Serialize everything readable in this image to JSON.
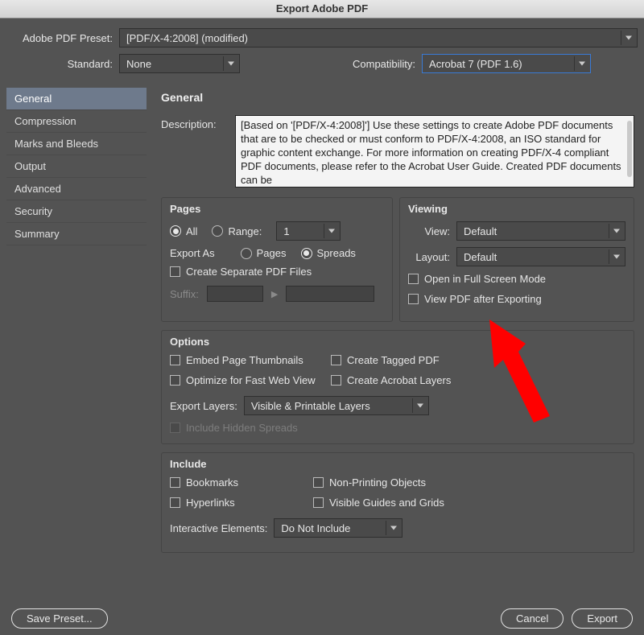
{
  "title": "Export Adobe PDF",
  "top": {
    "preset_label": "Adobe PDF Preset:",
    "preset_value": "[PDF/X-4:2008] (modified)",
    "standard_label": "Standard:",
    "standard_value": "None",
    "compat_label": "Compatibility:",
    "compat_value": "Acrobat 7 (PDF 1.6)"
  },
  "sidebar": {
    "items": [
      {
        "label": "General"
      },
      {
        "label": "Compression"
      },
      {
        "label": "Marks and Bleeds"
      },
      {
        "label": "Output"
      },
      {
        "label": "Advanced"
      },
      {
        "label": "Security"
      },
      {
        "label": "Summary"
      }
    ],
    "active_index": 0
  },
  "panel": {
    "title": "General",
    "description_label": "Description:",
    "description_text": "[Based on '[PDF/X-4:2008]'] Use these settings to create Adobe PDF documents that are to be checked or must conform to PDF/X-4:2008, an ISO standard for graphic content exchange.  For more information on creating PDF/X-4 compliant PDF documents, please refer to the Acrobat User Guide.  Created PDF documents can be"
  },
  "pages": {
    "title": "Pages",
    "all": "All",
    "range": "Range:",
    "range_value": "1",
    "export_as": "Export As",
    "pages_opt": "Pages",
    "spreads_opt": "Spreads",
    "separate": "Create Separate PDF Files",
    "suffix": "Suffix:"
  },
  "viewing": {
    "title": "Viewing",
    "view_label": "View:",
    "view_value": "Default",
    "layout_label": "Layout:",
    "layout_value": "Default",
    "fullscreen": "Open in Full Screen Mode",
    "view_after": "View PDF after Exporting"
  },
  "options": {
    "title": "Options",
    "embed_thumbs": "Embed Page Thumbnails",
    "fast_web": "Optimize for Fast Web View",
    "tagged": "Create Tagged PDF",
    "layers": "Create Acrobat Layers",
    "export_layers_label": "Export Layers:",
    "export_layers_value": "Visible & Printable Layers",
    "include_hidden": "Include Hidden Spreads"
  },
  "include": {
    "title": "Include",
    "bookmarks": "Bookmarks",
    "hyperlinks": "Hyperlinks",
    "nonprinting": "Non-Printing Objects",
    "guides": "Visible Guides and Grids",
    "interactive_label": "Interactive Elements:",
    "interactive_value": "Do Not Include"
  },
  "footer": {
    "save_preset": "Save Preset...",
    "cancel": "Cancel",
    "export": "Export"
  },
  "colors": {
    "accent": "#3a7bd5",
    "arrow": "#ff0000"
  }
}
